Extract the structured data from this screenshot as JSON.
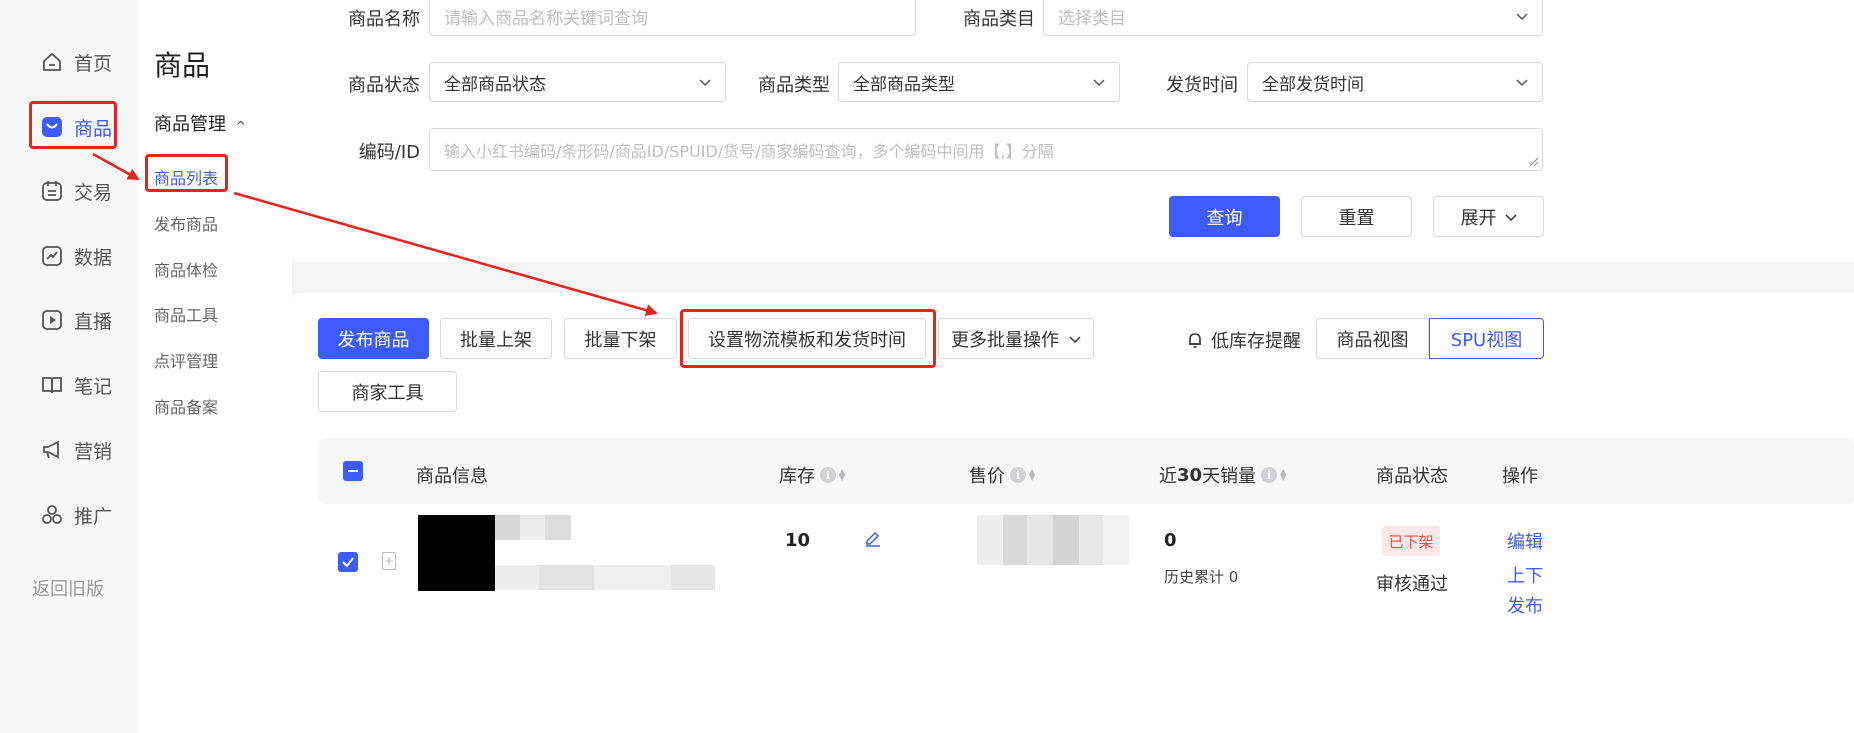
{
  "nav": {
    "items": [
      {
        "label": "首页",
        "icon": "home-icon"
      },
      {
        "label": "商品",
        "icon": "bag-icon"
      },
      {
        "label": "交易",
        "icon": "order-icon"
      },
      {
        "label": "数据",
        "icon": "chart-icon"
      },
      {
        "label": "直播",
        "icon": "play-icon"
      },
      {
        "label": "笔记",
        "icon": "book-icon"
      },
      {
        "label": "营销",
        "icon": "megaphone-icon"
      },
      {
        "label": "推广",
        "icon": "promo-icon"
      }
    ],
    "back_old": "返回旧版",
    "active_color": "#3d5afe"
  },
  "subnav": {
    "title": "商品",
    "group": "商品管理",
    "links": [
      "商品列表",
      "发布商品",
      "商品体检",
      "商品工具",
      "点评管理",
      "商品备案"
    ]
  },
  "filters": {
    "name_label": "商品名称",
    "name_placeholder": "请输入商品名称关键词查询",
    "category_label": "商品类目",
    "category_placeholder": "选择类目",
    "status_label": "商品状态",
    "status_value": "全部商品状态",
    "type_label": "商品类型",
    "type_value": "全部商品类型",
    "ship_label": "发货时间",
    "ship_value": "全部发货时间",
    "code_label": "编码/ID",
    "code_placeholder": "输入小红书编码/条形码/商品ID/SPUID/货号/商家编码查询，多个编码中间用【,】分隔",
    "query_btn": "查询",
    "reset_btn": "重置",
    "expand_btn": "展开"
  },
  "toolbar": {
    "publish": "发布商品",
    "batch_on": "批量上架",
    "batch_off": "批量下架",
    "logistics": "设置物流模板和发货时间",
    "more_batch": "更多批量操作",
    "low_stock": "低库存提醒",
    "product_view": "商品视图",
    "spu_view": "SPU视图",
    "merchant_tools": "商家工具"
  },
  "table": {
    "headers": {
      "info": "商品信息",
      "stock": "库存",
      "price": "售价",
      "sales_prefix": "近",
      "sales_num": "30",
      "sales_suffix": "天销量",
      "status": "商品状态",
      "ops": "操作"
    },
    "rows": [
      {
        "stock": "10",
        "sales": "0",
        "history": "历史累计 0",
        "status_badge": "已下架",
        "audit": "审核通过",
        "op_edit": "编辑",
        "op_shelf": "上下",
        "op_publish": "发布"
      }
    ]
  },
  "colors": {
    "accent": "#3d5afe",
    "annotation": "#e8221c",
    "badge_bg": "#fde8e8",
    "badge_text": "#e84a4a"
  }
}
